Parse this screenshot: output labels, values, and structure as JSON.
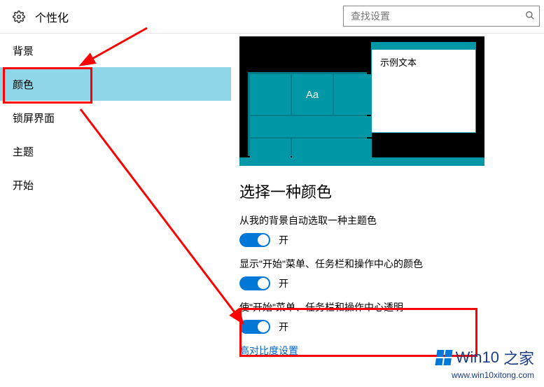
{
  "header": {
    "title": "个性化"
  },
  "search": {
    "placeholder": "查找设置"
  },
  "sidebar": {
    "items": [
      {
        "label": "背景",
        "selected": false
      },
      {
        "label": "颜色",
        "selected": true
      },
      {
        "label": "锁屏界面",
        "selected": false
      },
      {
        "label": "主题",
        "selected": false
      },
      {
        "label": "开始",
        "selected": false
      }
    ]
  },
  "preview": {
    "tile_text": "Aa",
    "window_sample_text": "示例文本"
  },
  "main": {
    "section_title": "选择一种颜色",
    "settings": [
      {
        "label": "从我的背景自动选取一种主题色",
        "state": "开",
        "on": true
      },
      {
        "label": "显示\"开始\"菜单、任务栏和操作中心的颜色",
        "state": "开",
        "on": true
      },
      {
        "label": "使\"开始\"菜单、任务栏和操作中心透明",
        "state": "开",
        "on": true
      }
    ],
    "link": "高对比度设置"
  },
  "watermark": {
    "brand_a": "Win10",
    "brand_b": "之家",
    "url": "www.win10xitong.com"
  },
  "colors": {
    "accent": "#0078d7",
    "teal": "#0097a7",
    "sidebar_selected": "#8fd6e8",
    "annotation": "#ff0000"
  }
}
